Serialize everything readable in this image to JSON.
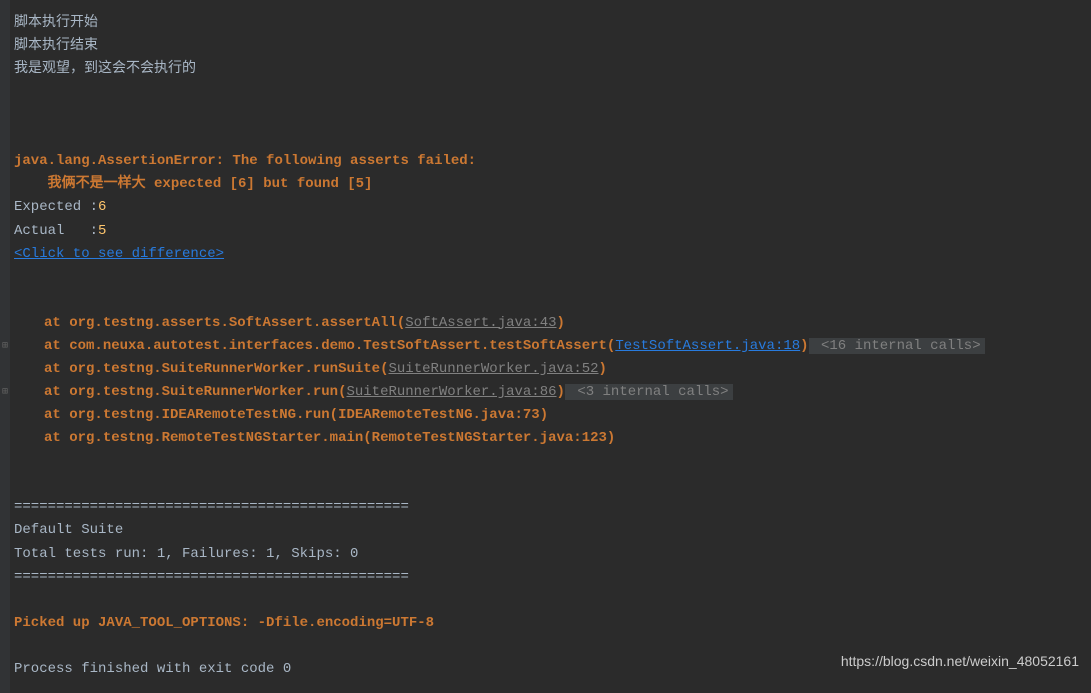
{
  "output": {
    "start_msg": "脚本执行开始",
    "end_msg": "脚本执行结束",
    "observe_msg": "我是观望，到这会不会执行的"
  },
  "error": {
    "header": "java.lang.AssertionError: The following asserts failed:",
    "assert_msg": "我俩不是一样大 expected [6] but found [5]",
    "expected_label": "Expected :",
    "expected_value": "6",
    "actual_label": "Actual   :",
    "actual_value": "5",
    "diff_link": "<Click to see difference>"
  },
  "stack": [
    {
      "at": "at ",
      "method": "org.testng.asserts.SoftAssert.assertAll(",
      "file": "SoftAssert.java:43",
      "close": ")",
      "internal": "",
      "file_link_style": "grey",
      "expand": false
    },
    {
      "at": "at ",
      "method": "com.neuxa.autotest.interfaces.demo.TestSoftAssert.testSoftAssert(",
      "file": "TestSoftAssert.java:18",
      "close": ")",
      "internal": " <16 internal calls>",
      "file_link_style": "blue",
      "expand": true
    },
    {
      "at": "at ",
      "method": "org.testng.SuiteRunnerWorker.runSuite(",
      "file": "SuiteRunnerWorker.java:52",
      "close": ")",
      "internal": "",
      "file_link_style": "grey",
      "expand": false
    },
    {
      "at": "at ",
      "method": "org.testng.SuiteRunnerWorker.run(",
      "file": "SuiteRunnerWorker.java:86",
      "close": ")",
      "internal": " <3 internal calls>",
      "file_link_style": "grey",
      "expand": true
    },
    {
      "at": "at ",
      "method": "org.testng.IDEARemoteTestNG.run(IDEARemoteTestNG.java:73)",
      "file": "",
      "close": "",
      "internal": "",
      "file_link_style": "none",
      "expand": false
    },
    {
      "at": "at ",
      "method": "org.testng.RemoteTestNGStarter.main(RemoteTestNGStarter.java:123)",
      "file": "",
      "close": "",
      "internal": "",
      "file_link_style": "none",
      "expand": false
    }
  ],
  "summary": {
    "divider": "===============================================",
    "suite_name": "Default Suite",
    "results": "Total tests run: 1, Failures: 1, Skips: 0"
  },
  "footer": {
    "java_opts": "Picked up JAVA_TOOL_OPTIONS: -Dfile.encoding=UTF-8",
    "exit": "Process finished with exit code 0"
  },
  "watermark": "https://blog.csdn.net/weixin_48052161"
}
